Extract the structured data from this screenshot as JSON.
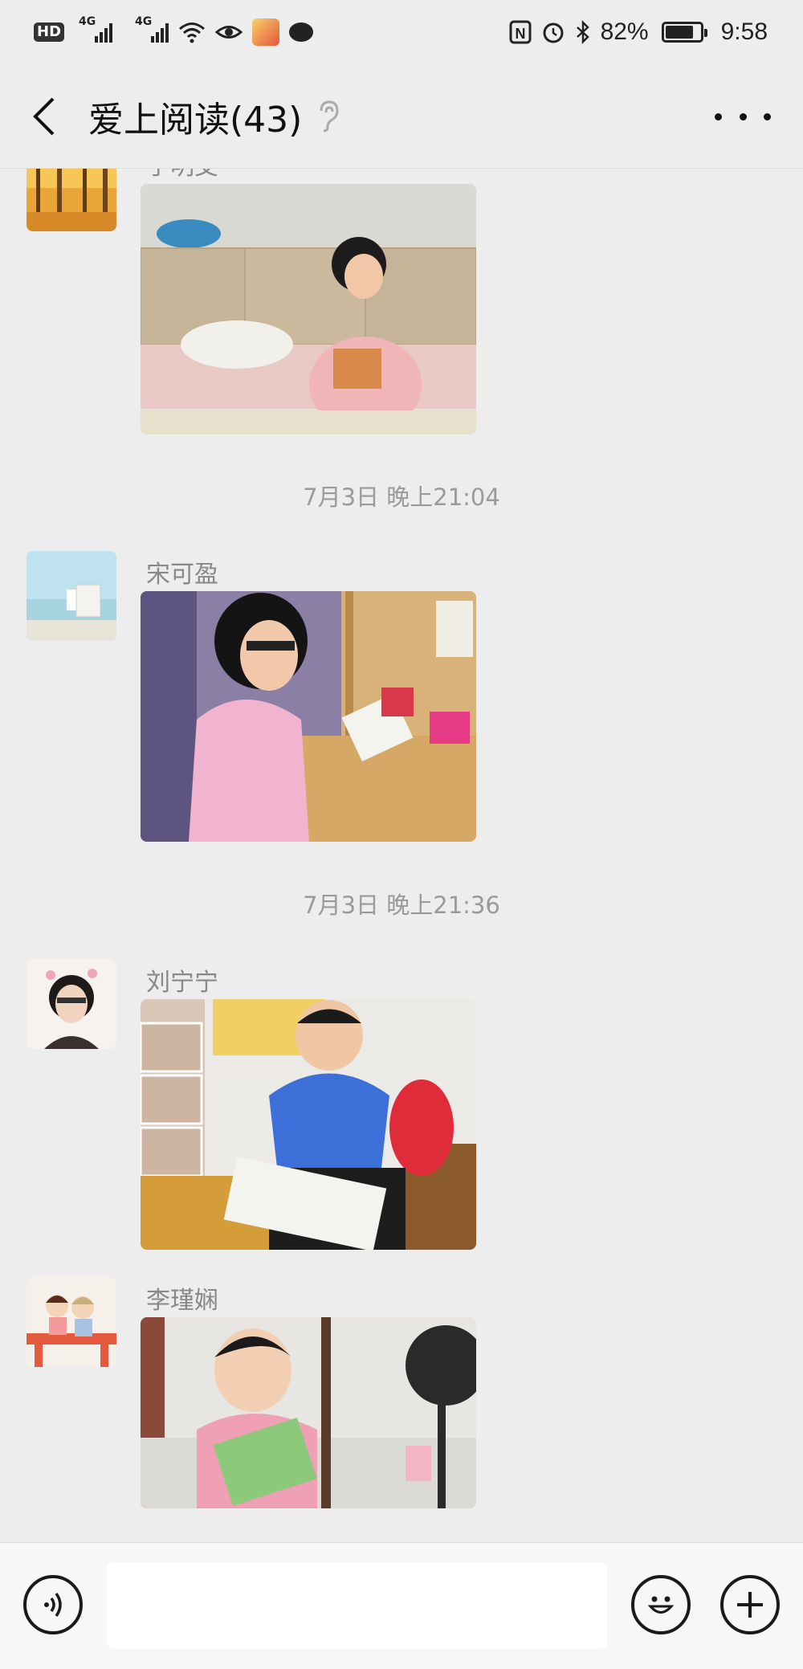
{
  "status_bar": {
    "hd": "HD",
    "sim": "2",
    "net1": "4G",
    "net2": "4G",
    "nfc": "N",
    "battery": "82%",
    "battery_level": 0.82,
    "time": "9:58"
  },
  "header": {
    "title": "爱上阅读(43)"
  },
  "messages": [
    {
      "sender": "于明艾",
      "photo": "girl-reading-on-sofa"
    },
    {
      "sender": "宋可盈",
      "photo": "girl-reading-at-desk"
    },
    {
      "sender": "刘宁宁",
      "photo": "boy-reading-picture-book"
    },
    {
      "sender": "李瑾娴",
      "photo": "girl-reading-green-book"
    }
  ],
  "timestamps": [
    "7月3日 晚上21:04",
    "7月3日 晚上21:36"
  ],
  "input": {
    "placeholder": ""
  },
  "icons": {
    "back": "back-arrow-icon",
    "mute": "ear-icon",
    "more": "more-icon",
    "voice": "voice-icon",
    "emoji": "emoji-icon",
    "plus": "plus-icon"
  }
}
